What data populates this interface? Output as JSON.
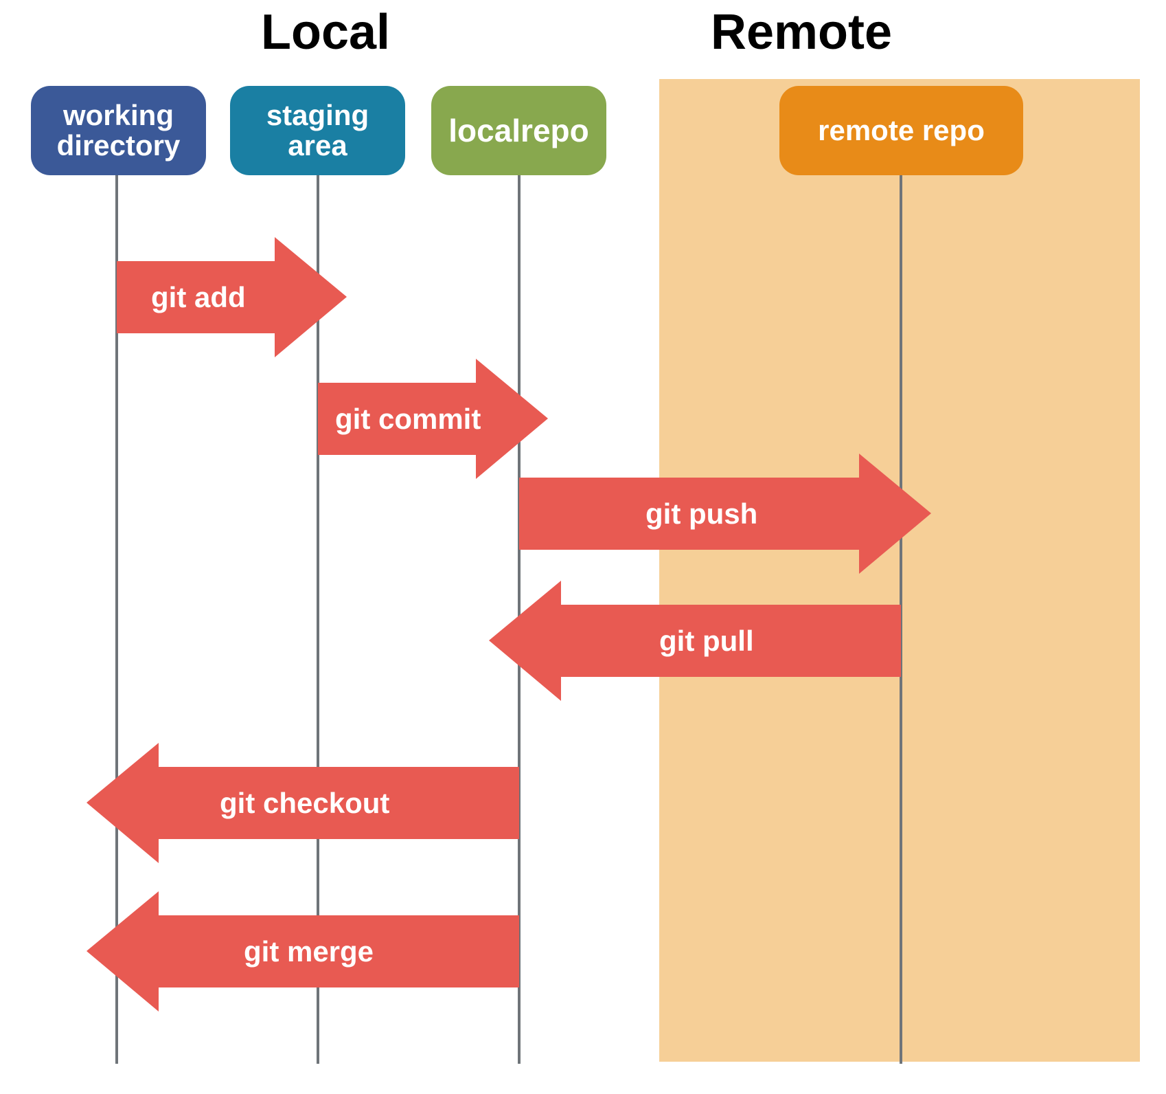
{
  "sections": {
    "local": "Local",
    "remote": "Remote"
  },
  "columns": {
    "working": {
      "label": "working directory",
      "color": "#3b5998"
    },
    "staging": {
      "label": "staging area",
      "color": "#1a7fa3"
    },
    "localrepo": {
      "label": "localrepo",
      "color": "#88a84e"
    },
    "remoterepo": {
      "label": "remote repo",
      "color": "#e88b18"
    }
  },
  "arrows": {
    "add": {
      "label": "git add",
      "from": "working",
      "to": "staging",
      "dir": "right"
    },
    "commit": {
      "label": "git commit",
      "from": "staging",
      "to": "localrepo",
      "dir": "right"
    },
    "push": {
      "label": "git push",
      "from": "localrepo",
      "to": "remoterepo",
      "dir": "right"
    },
    "pull": {
      "label": "git pull",
      "from": "remoterepo",
      "to": "localrepo",
      "dir": "left"
    },
    "checkout": {
      "label": "git checkout",
      "from": "localrepo",
      "to": "working",
      "dir": "left"
    },
    "merge": {
      "label": "git merge",
      "from": "localrepo",
      "to": "working",
      "dir": "left"
    }
  },
  "colors": {
    "arrow_fill": "#e85a52",
    "remote_bg": "#f6cf97",
    "grid_line": "#6f7479"
  },
  "chart_data": {
    "type": "flow",
    "lanes": [
      "working directory",
      "staging area",
      "localrepo",
      "remote repo"
    ],
    "groups": {
      "Local": [
        "working directory",
        "staging area",
        "localrepo"
      ],
      "Remote": [
        "remote repo"
      ]
    },
    "flows": [
      {
        "label": "git add",
        "from": "working directory",
        "to": "staging area"
      },
      {
        "label": "git commit",
        "from": "staging area",
        "to": "localrepo"
      },
      {
        "label": "git push",
        "from": "localrepo",
        "to": "remote repo"
      },
      {
        "label": "git pull",
        "from": "remote repo",
        "to": "localrepo"
      },
      {
        "label": "git checkout",
        "from": "localrepo",
        "to": "working directory"
      },
      {
        "label": "git merge",
        "from": "localrepo",
        "to": "working directory"
      }
    ]
  }
}
